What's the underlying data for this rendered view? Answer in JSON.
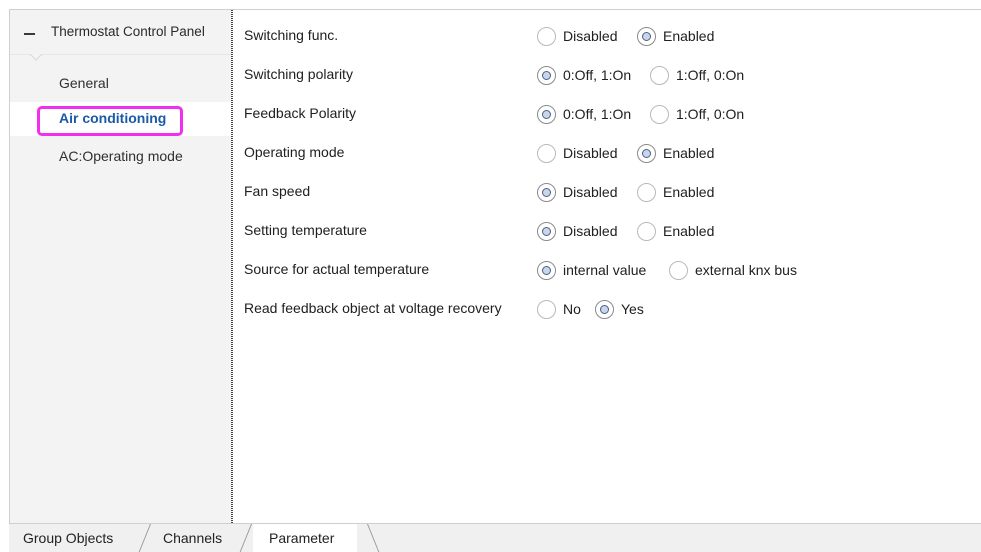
{
  "sidebar": {
    "tree_title": "Thermostat Control Panel",
    "collapse_symbol": "minus-icon",
    "items": [
      {
        "label": "General",
        "selected": false
      },
      {
        "label": "Air conditioning",
        "selected": true
      },
      {
        "label": "AC:Operating mode",
        "selected": false
      }
    ]
  },
  "parameters": [
    {
      "label": "Switching func.",
      "options": [
        "Disabled",
        "Enabled"
      ],
      "selected": 1
    },
    {
      "label": "Switching polarity",
      "options": [
        "0:Off, 1:On",
        "1:Off, 0:On"
      ],
      "selected": 0
    },
    {
      "label": "Feedback Polarity",
      "options": [
        "0:Off, 1:On",
        "1:Off, 0:On"
      ],
      "selected": 0
    },
    {
      "label": "Operating mode",
      "options": [
        "Disabled",
        "Enabled"
      ],
      "selected": 1
    },
    {
      "label": "Fan speed",
      "options": [
        "Disabled",
        "Enabled"
      ],
      "selected": 0
    },
    {
      "label": "Setting temperature",
      "options": [
        "Disabled",
        "Enabled"
      ],
      "selected": 0
    },
    {
      "label": "Source for actual temperature",
      "options": [
        "internal value",
        "external knx bus"
      ],
      "selected": 0
    },
    {
      "label": "Read feedback object at voltage recovery",
      "options": [
        "No",
        "Yes"
      ],
      "selected": 1
    }
  ],
  "tabs": [
    {
      "label": "Group Objects",
      "active": false
    },
    {
      "label": "Channels",
      "active": false
    },
    {
      "label": "Parameter",
      "active": true
    }
  ],
  "colors": {
    "highlight_box": "#f02ff0",
    "selected_item_text": "#1a5aa8"
  }
}
